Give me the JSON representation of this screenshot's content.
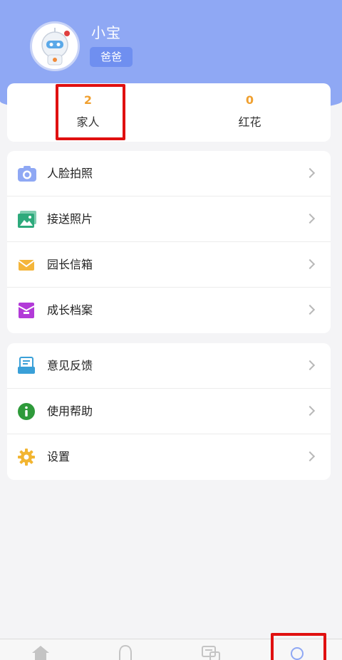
{
  "user": {
    "name": "小宝",
    "role": "爸爸"
  },
  "stats": [
    {
      "value": "2",
      "label": "家人"
    },
    {
      "value": "0",
      "label": "红花"
    }
  ],
  "menu_group_1": [
    {
      "label": "人脸拍照",
      "icon": "camera-icon"
    },
    {
      "label": "接送照片",
      "icon": "photo-icon"
    },
    {
      "label": "园长信箱",
      "icon": "mail-icon"
    },
    {
      "label": "成长档案",
      "icon": "archive-icon"
    }
  ],
  "menu_group_2": [
    {
      "label": "意见反馈",
      "icon": "feedback-icon"
    },
    {
      "label": "使用帮助",
      "icon": "info-icon"
    },
    {
      "label": "设置",
      "icon": "gear-icon"
    }
  ],
  "tabbar": [
    "home-icon",
    "bell-icon",
    "chat-icon",
    "profile-icon"
  ],
  "colors": {
    "header": "#8fa8f4",
    "accent": "#f0a030",
    "highlight": "#e01010"
  }
}
